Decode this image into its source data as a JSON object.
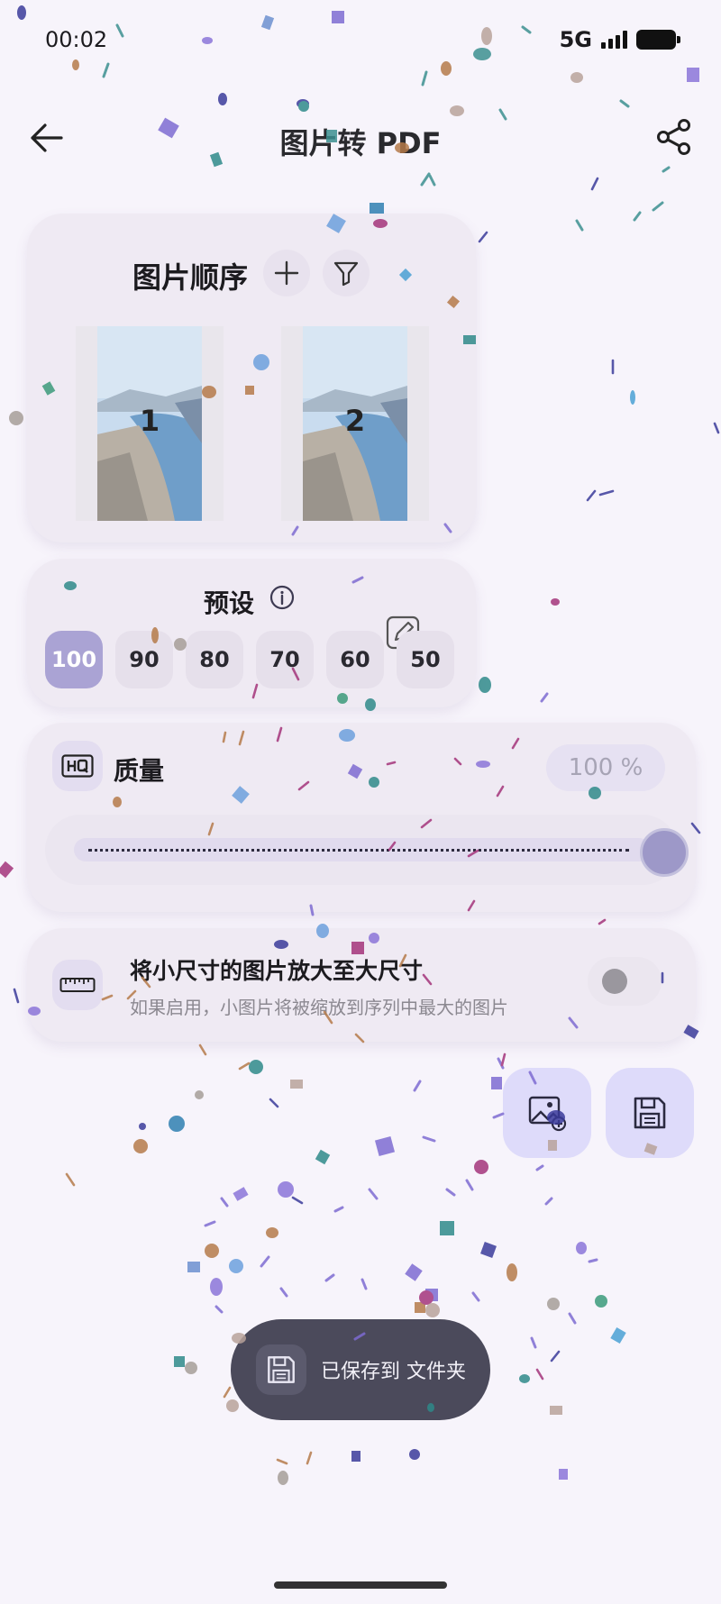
{
  "status": {
    "time": "00:02",
    "network": "5G"
  },
  "topbar": {
    "title": "图片转 PDF"
  },
  "order": {
    "title": "图片顺序",
    "images": [
      {
        "number": "1"
      },
      {
        "number": "2"
      }
    ]
  },
  "preset": {
    "title": "预设",
    "options": [
      "100",
      "90",
      "80",
      "70",
      "60",
      "50"
    ],
    "selected": "100"
  },
  "quality": {
    "title": "质量",
    "value_text": "100 %",
    "value": 100,
    "min": 0,
    "max": 100
  },
  "upscale": {
    "title": "将小尺寸的图片放大至大尺寸",
    "subtitle": "如果启用，小图片将被缩放到序列中最大的图片",
    "enabled": false
  },
  "toast": {
    "text": "已保存到 文件夹"
  },
  "colors": {
    "accent": "#aaa3d4",
    "fab": "#dedbfa",
    "toast_bg": "#4b4a5b"
  }
}
